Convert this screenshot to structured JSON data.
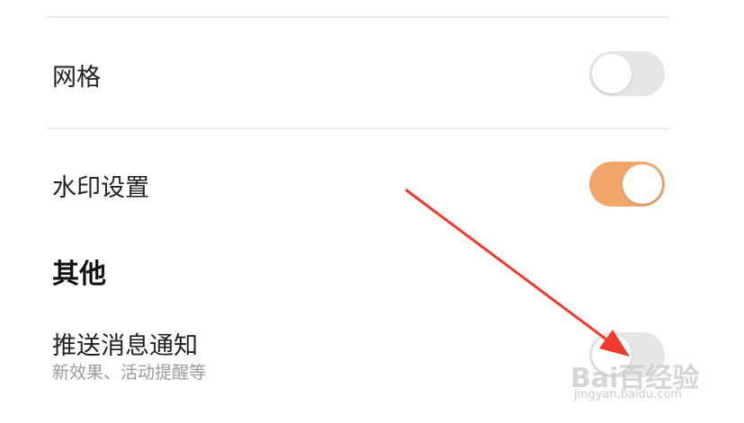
{
  "settings": {
    "grid": {
      "label": "网格",
      "enabled": false
    },
    "watermark": {
      "label": "水印设置",
      "enabled": true
    },
    "section_other": {
      "title": "其他"
    },
    "push": {
      "label": "推送消息通知",
      "sublabel": "新效果、活动提醒等",
      "enabled": false
    }
  },
  "overlay": {
    "brand": "Bai百经验",
    "url": "jingyan.baidu.com"
  },
  "colors": {
    "toggle_on": "#f2a66b",
    "toggle_off": "#e6e6e6",
    "arrow": "#f03a2e",
    "divider": "#ececec"
  },
  "icons": {
    "annotation": "red-arrow-icon"
  }
}
